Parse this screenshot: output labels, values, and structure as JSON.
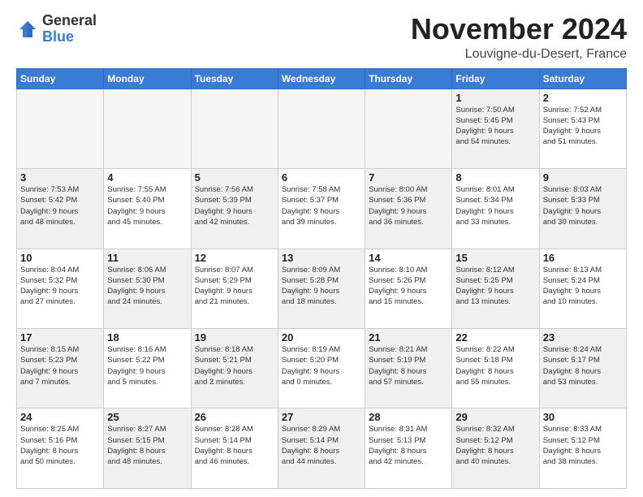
{
  "logo": {
    "general": "General",
    "blue": "Blue"
  },
  "title": "November 2024",
  "location": "Louvigne-du-Desert, France",
  "days_header": [
    "Sunday",
    "Monday",
    "Tuesday",
    "Wednesday",
    "Thursday",
    "Friday",
    "Saturday"
  ],
  "weeks": [
    [
      {
        "day": "",
        "info": "",
        "empty": true
      },
      {
        "day": "",
        "info": "",
        "empty": true
      },
      {
        "day": "",
        "info": "",
        "empty": true
      },
      {
        "day": "",
        "info": "",
        "empty": true
      },
      {
        "day": "",
        "info": "",
        "empty": true
      },
      {
        "day": "1",
        "info": "Sunrise: 7:50 AM\nSunset: 5:45 PM\nDaylight: 9 hours\nand 54 minutes."
      },
      {
        "day": "2",
        "info": "Sunrise: 7:52 AM\nSunset: 5:43 PM\nDaylight: 9 hours\nand 51 minutes."
      }
    ],
    [
      {
        "day": "3",
        "info": "Sunrise: 7:53 AM\nSunset: 5:42 PM\nDaylight: 9 hours\nand 48 minutes."
      },
      {
        "day": "4",
        "info": "Sunrise: 7:55 AM\nSunset: 5:40 PM\nDaylight: 9 hours\nand 45 minutes."
      },
      {
        "day": "5",
        "info": "Sunrise: 7:56 AM\nSunset: 5:39 PM\nDaylight: 9 hours\nand 42 minutes."
      },
      {
        "day": "6",
        "info": "Sunrise: 7:58 AM\nSunset: 5:37 PM\nDaylight: 9 hours\nand 39 minutes."
      },
      {
        "day": "7",
        "info": "Sunrise: 8:00 AM\nSunset: 5:36 PM\nDaylight: 9 hours\nand 36 minutes."
      },
      {
        "day": "8",
        "info": "Sunrise: 8:01 AM\nSunset: 5:34 PM\nDaylight: 9 hours\nand 33 minutes."
      },
      {
        "day": "9",
        "info": "Sunrise: 8:03 AM\nSunset: 5:33 PM\nDaylight: 9 hours\nand 30 minutes."
      }
    ],
    [
      {
        "day": "10",
        "info": "Sunrise: 8:04 AM\nSunset: 5:32 PM\nDaylight: 9 hours\nand 27 minutes."
      },
      {
        "day": "11",
        "info": "Sunrise: 8:06 AM\nSunset: 5:30 PM\nDaylight: 9 hours\nand 24 minutes."
      },
      {
        "day": "12",
        "info": "Sunrise: 8:07 AM\nSunset: 5:29 PM\nDaylight: 9 hours\nand 21 minutes."
      },
      {
        "day": "13",
        "info": "Sunrise: 8:09 AM\nSunset: 5:28 PM\nDaylight: 9 hours\nand 18 minutes."
      },
      {
        "day": "14",
        "info": "Sunrise: 8:10 AM\nSunset: 5:26 PM\nDaylight: 9 hours\nand 15 minutes."
      },
      {
        "day": "15",
        "info": "Sunrise: 8:12 AM\nSunset: 5:25 PM\nDaylight: 9 hours\nand 13 minutes."
      },
      {
        "day": "16",
        "info": "Sunrise: 8:13 AM\nSunset: 5:24 PM\nDaylight: 9 hours\nand 10 minutes."
      }
    ],
    [
      {
        "day": "17",
        "info": "Sunrise: 8:15 AM\nSunset: 5:23 PM\nDaylight: 9 hours\nand 7 minutes."
      },
      {
        "day": "18",
        "info": "Sunrise: 8:16 AM\nSunset: 5:22 PM\nDaylight: 9 hours\nand 5 minutes."
      },
      {
        "day": "19",
        "info": "Sunrise: 8:18 AM\nSunset: 5:21 PM\nDaylight: 9 hours\nand 2 minutes."
      },
      {
        "day": "20",
        "info": "Sunrise: 8:19 AM\nSunset: 5:20 PM\nDaylight: 9 hours\nand 0 minutes."
      },
      {
        "day": "21",
        "info": "Sunrise: 8:21 AM\nSunset: 5:19 PM\nDaylight: 8 hours\nand 57 minutes."
      },
      {
        "day": "22",
        "info": "Sunrise: 8:22 AM\nSunset: 5:18 PM\nDaylight: 8 hours\nand 55 minutes."
      },
      {
        "day": "23",
        "info": "Sunrise: 8:24 AM\nSunset: 5:17 PM\nDaylight: 8 hours\nand 53 minutes."
      }
    ],
    [
      {
        "day": "24",
        "info": "Sunrise: 8:25 AM\nSunset: 5:16 PM\nDaylight: 8 hours\nand 50 minutes."
      },
      {
        "day": "25",
        "info": "Sunrise: 8:27 AM\nSunset: 5:15 PM\nDaylight: 8 hours\nand 48 minutes."
      },
      {
        "day": "26",
        "info": "Sunrise: 8:28 AM\nSunset: 5:14 PM\nDaylight: 8 hours\nand 46 minutes."
      },
      {
        "day": "27",
        "info": "Sunrise: 8:29 AM\nSunset: 5:14 PM\nDaylight: 8 hours\nand 44 minutes."
      },
      {
        "day": "28",
        "info": "Sunrise: 8:31 AM\nSunset: 5:13 PM\nDaylight: 8 hours\nand 42 minutes."
      },
      {
        "day": "29",
        "info": "Sunrise: 8:32 AM\nSunset: 5:12 PM\nDaylight: 8 hours\nand 40 minutes."
      },
      {
        "day": "30",
        "info": "Sunrise: 8:33 AM\nSunset: 5:12 PM\nDaylight: 8 hours\nand 38 minutes."
      }
    ]
  ]
}
